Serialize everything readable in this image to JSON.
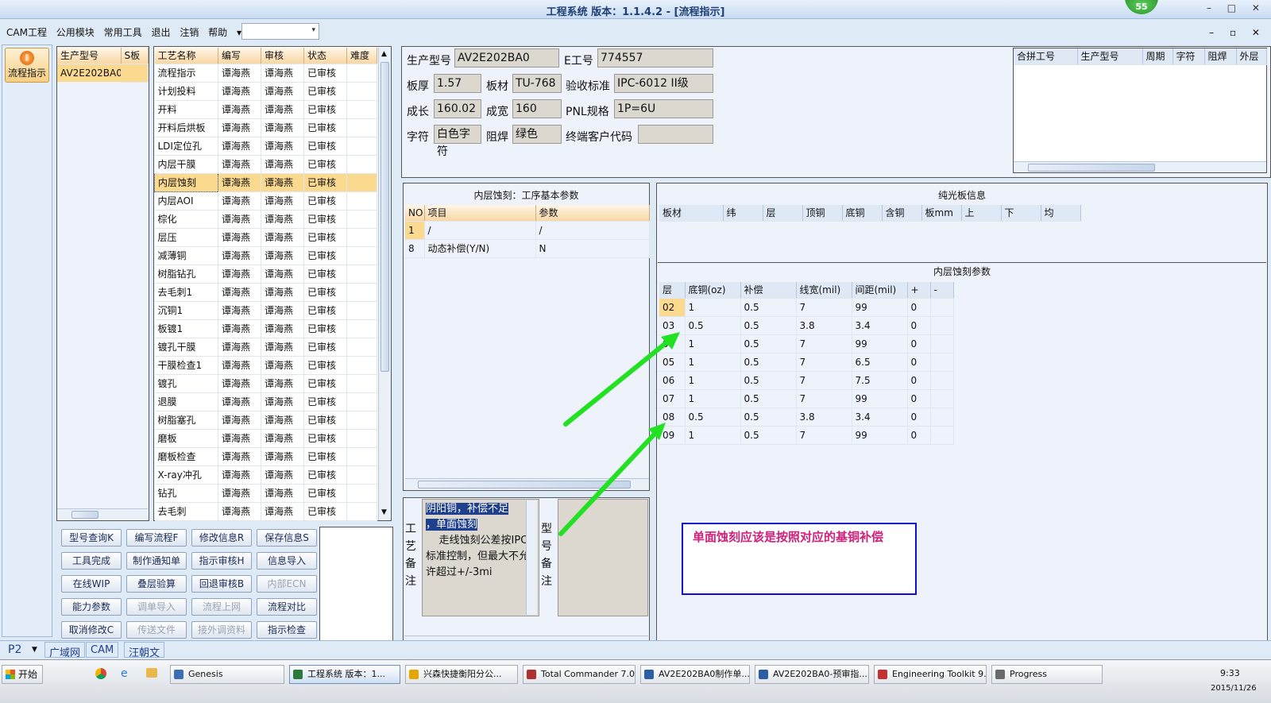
{
  "window": {
    "title": "工程系统  版本：1.1.4.2 - [流程指示]",
    "badge": "55",
    "controls": "– □ ✕",
    "mdi_controls": "– ▫ ✕"
  },
  "menu": [
    "CAM工程",
    "公用模块",
    "常用工具",
    "退出",
    "注销",
    "帮助",
    "▾"
  ],
  "nav": {
    "label": "流程指示"
  },
  "models": {
    "headers": [
      "生产型号",
      "S板"
    ],
    "rows": [
      [
        "AV2E202BA0",
        ""
      ]
    ]
  },
  "process": {
    "headers": [
      "工艺名称",
      "编写",
      "审核",
      "状态",
      "难度"
    ],
    "rows": [
      [
        "流程指示",
        "谭海燕",
        "谭海燕",
        "已审核",
        ""
      ],
      [
        "计划投料",
        "谭海燕",
        "谭海燕",
        "已审核",
        ""
      ],
      [
        "开料",
        "谭海燕",
        "谭海燕",
        "已审核",
        ""
      ],
      [
        "开料后烘板",
        "谭海燕",
        "谭海燕",
        "已审核",
        ""
      ],
      [
        "LDI定位孔",
        "谭海燕",
        "谭海燕",
        "已审核",
        ""
      ],
      [
        "内层干膜",
        "谭海燕",
        "谭海燕",
        "已审核",
        ""
      ],
      [
        "内层蚀刻",
        "谭海燕",
        "谭海燕",
        "已审核",
        ""
      ],
      [
        "内层AOI",
        "谭海燕",
        "谭海燕",
        "已审核",
        ""
      ],
      [
        "棕化",
        "谭海燕",
        "谭海燕",
        "已审核",
        ""
      ],
      [
        "层压",
        "谭海燕",
        "谭海燕",
        "已审核",
        ""
      ],
      [
        "减薄铜",
        "谭海燕",
        "谭海燕",
        "已审核",
        ""
      ],
      [
        "树脂钻孔",
        "谭海燕",
        "谭海燕",
        "已审核",
        ""
      ],
      [
        "去毛刺1",
        "谭海燕",
        "谭海燕",
        "已审核",
        ""
      ],
      [
        "沉铜1",
        "谭海燕",
        "谭海燕",
        "已审核",
        ""
      ],
      [
        "板镀1",
        "谭海燕",
        "谭海燕",
        "已审核",
        ""
      ],
      [
        "镀孔干膜",
        "谭海燕",
        "谭海燕",
        "已审核",
        ""
      ],
      [
        "干膜检查1",
        "谭海燕",
        "谭海燕",
        "已审核",
        ""
      ],
      [
        "镀孔",
        "谭海燕",
        "谭海燕",
        "已审核",
        ""
      ],
      [
        "退膜",
        "谭海燕",
        "谭海燕",
        "已审核",
        ""
      ],
      [
        "树脂塞孔",
        "谭海燕",
        "谭海燕",
        "已审核",
        ""
      ],
      [
        "磨板",
        "谭海燕",
        "谭海燕",
        "已审核",
        ""
      ],
      [
        "磨板检查",
        "谭海燕",
        "谭海燕",
        "已审核",
        ""
      ],
      [
        "X-ray冲孔",
        "谭海燕",
        "谭海燕",
        "已审核",
        ""
      ],
      [
        "钻孔",
        "谭海燕",
        "谭海燕",
        "已审核",
        ""
      ],
      [
        "去毛刺",
        "谭海燕",
        "谭海燕",
        "已审核",
        ""
      ]
    ],
    "selected_index": 6
  },
  "buttons": [
    [
      "型号查询K",
      "编写流程F",
      "修改信息R",
      "保存信息S"
    ],
    [
      "工具完成",
      "制作通知单",
      "指示审核H",
      "信息导入"
    ],
    [
      "在线WIP",
      "叠层验算",
      "回退审核B",
      "内部ECN"
    ],
    [
      "能力参数",
      "调单导入",
      "流程上网",
      "流程对比"
    ],
    [
      "取消修改C",
      "传送文件",
      "接外调资料",
      "指示检查"
    ]
  ],
  "disabled_buttons": [
    "内部ECN",
    "调单导入",
    "流程上网",
    "传送文件",
    "接外调资料"
  ],
  "info": {
    "model_lbl": "生产型号",
    "model": "AV2E202BA0",
    "eno_lbl": "E工号",
    "eno": "774557",
    "thick_lbl": "板厚",
    "thick": "1.57",
    "mat_lbl": "板材",
    "mat": "TU-768",
    "std_lbl": "验收标准",
    "std": "IPC-6012 II级",
    "len_lbl": "成长",
    "len": "160.02",
    "wid_lbl": "成宽",
    "wid": "160",
    "pnl_lbl": "PNL规格",
    "pnl": "1P=6U",
    "char_lbl": "字符",
    "char": "白色字符",
    "mask_lbl": "阻焊",
    "mask": "绿色",
    "cust_lbl": "终端客户代码",
    "cust": ""
  },
  "merge": {
    "headers": [
      "合拼工号",
      "生产型号",
      "周期",
      "字符",
      "阻焊",
      "外层"
    ]
  },
  "basic": {
    "title": "内层蚀刻：工序基本参数",
    "headers": [
      "NO",
      "项目",
      "参数"
    ],
    "rows": [
      [
        "1",
        "/",
        "/"
      ],
      [
        "8",
        "动态补偿(Y/N)",
        "N"
      ]
    ]
  },
  "bare": {
    "title": "纯光板信息",
    "headers": [
      "板材",
      "纬",
      "层",
      "顶铜",
      "底铜",
      "含铜",
      "板mm",
      "上",
      "下",
      "均"
    ]
  },
  "etch": {
    "title": "内层蚀刻参数",
    "headers": [
      "层",
      "底铜(oz)",
      "补偿",
      "线宽(mil)",
      "间距(mil)",
      "+",
      "-"
    ],
    "rows": [
      [
        "02",
        "1",
        "0.5",
        "7",
        "99",
        "0",
        ""
      ],
      [
        "03",
        "0.5",
        "0.5",
        "3.8",
        "3.4",
        "0",
        ""
      ],
      [
        "04",
        "1",
        "0.5",
        "7",
        "99",
        "0",
        ""
      ],
      [
        "05",
        "1",
        "0.5",
        "7",
        "6.5",
        "0",
        ""
      ],
      [
        "06",
        "1",
        "0.5",
        "7",
        "7.5",
        "0",
        ""
      ],
      [
        "07",
        "1",
        "0.5",
        "7",
        "99",
        "0",
        ""
      ],
      [
        "08",
        "0.5",
        "0.5",
        "3.8",
        "3.4",
        "0",
        ""
      ],
      [
        "09",
        "1",
        "0.5",
        "7",
        "99",
        "0",
        ""
      ]
    ]
  },
  "remark": {
    "label": "工艺备注",
    "hl1": "阴阳铜，补偿不足",
    "hl2": "，单面蚀刻",
    "body": "    走线蚀刻公差按IPC标准控制，但最大不允许超过+/-3mi",
    "type_label": "型号备注"
  },
  "annotation": "单面蚀刻应该是按照对应的基铜补偿",
  "status": {
    "p2": "P2",
    "tabs": [
      "广域网",
      "CAM",
      "汪朝文"
    ]
  },
  "taskbar": {
    "start": "开始",
    "items": [
      "Genesis",
      "工程系统  版本：1...",
      "兴森快捷衡阳分公...",
      "Total Commander 7.0...",
      "AV2E202BA0制作单...",
      "AV2E202BA0-预审指...",
      "Engineering Toolkit 9....",
      "Progress"
    ],
    "clock": "9:33",
    "date": "2015/11/26"
  },
  "colors": {
    "accent": "#fbd98f",
    "arrow": "#22e022",
    "note_border": "#1010cc",
    "note_text": "#d0207a"
  }
}
